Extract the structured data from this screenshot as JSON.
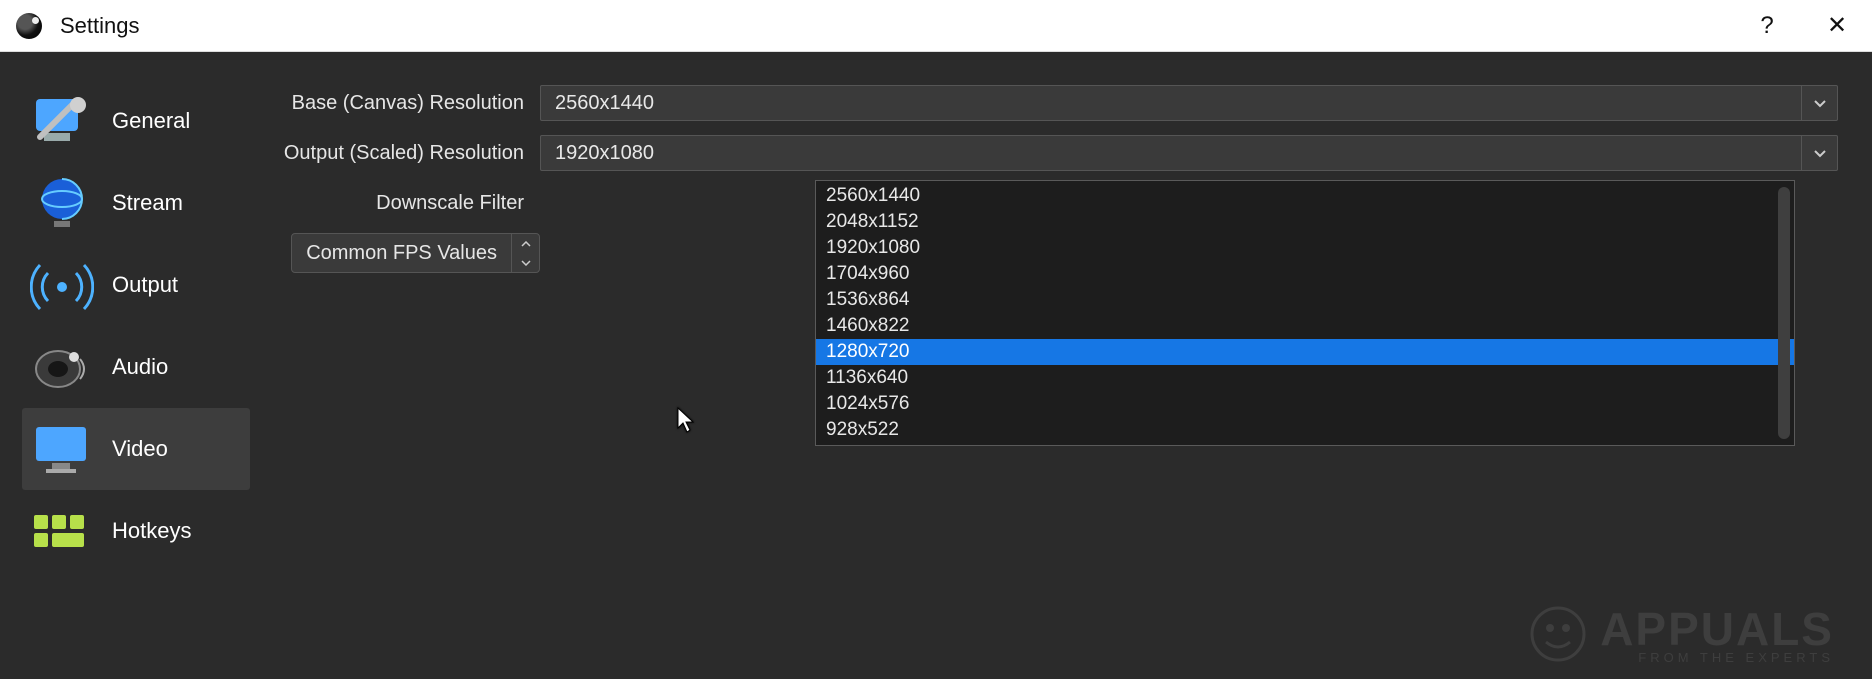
{
  "window": {
    "title": "Settings",
    "help": "?",
    "close": "✕"
  },
  "sidebar": {
    "items": [
      {
        "label": "General"
      },
      {
        "label": "Stream"
      },
      {
        "label": "Output"
      },
      {
        "label": "Audio"
      },
      {
        "label": "Video"
      },
      {
        "label": "Hotkeys"
      }
    ]
  },
  "form": {
    "base_label": "Base (Canvas) Resolution",
    "base_value": "2560x1440",
    "output_label": "Output (Scaled) Resolution",
    "output_value": "1920x1080",
    "filter_label": "Downscale Filter",
    "fps_label": "Common FPS Values"
  },
  "dropdown": {
    "options": [
      "2560x1440",
      "2048x1152",
      "1920x1080",
      "1704x960",
      "1536x864",
      "1460x822",
      "1280x720",
      "1136x640",
      "1024x576",
      "928x522"
    ],
    "highlighted": "1280x720"
  },
  "watermark": {
    "brand": "APPUALS",
    "tagline": "FROM THE EXPERTS"
  }
}
